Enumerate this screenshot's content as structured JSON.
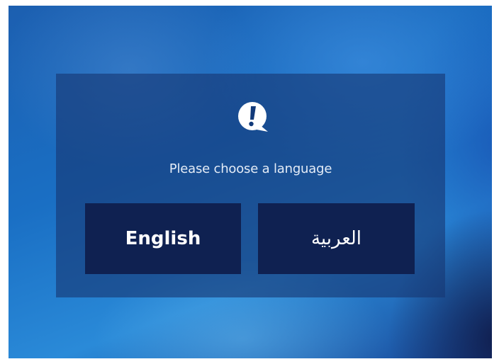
{
  "dialog": {
    "prompt": "Please choose a language",
    "icon": "alert-speech-bubble-icon"
  },
  "languages": {
    "english_label": "English",
    "arabic_label": "العربية"
  },
  "colors": {
    "background": "#1a6fc4",
    "panel": "#16376f",
    "button": "#0f2151",
    "text": "#ffffff"
  }
}
